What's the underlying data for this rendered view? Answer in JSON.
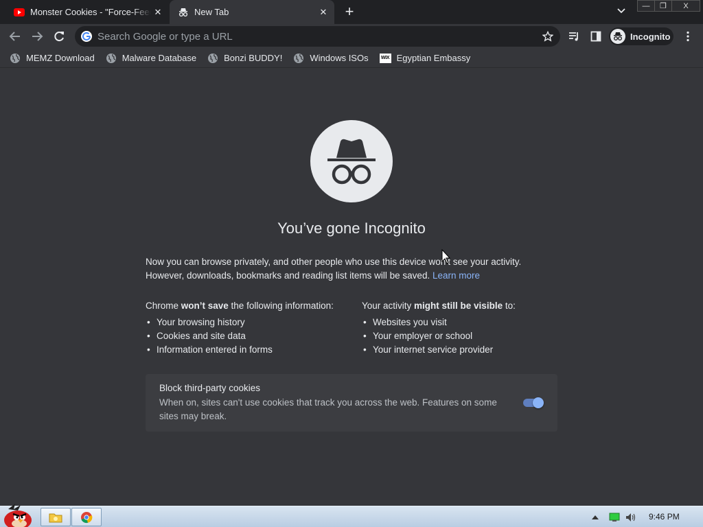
{
  "browser": {
    "tabs": [
      {
        "title": "Monster Cookies - \"Force-Feed",
        "favicon": "youtube-icon",
        "active": false
      },
      {
        "title": "New Tab",
        "favicon": "incognito-icon",
        "active": true
      }
    ],
    "new_tab_symbol": "+",
    "window_controls": {
      "minimize": "—",
      "maximize": "❐",
      "close": "X"
    },
    "omnibox": {
      "placeholder": "Search Google or type a URL",
      "value": ""
    },
    "profile_label": "Incognito",
    "bookmarks": [
      {
        "label": "MEMZ Download",
        "icon": "globe-icon"
      },
      {
        "label": "Malware Database",
        "icon": "globe-icon"
      },
      {
        "label": "Bonzi BUDDY!",
        "icon": "globe-icon"
      },
      {
        "label": "Windows ISOs",
        "icon": "globe-icon"
      },
      {
        "label": "Egyptian Embassy",
        "icon": "wix-icon",
        "icon_text": "WIX"
      }
    ]
  },
  "incognito_page": {
    "heading": "You’ve gone Incognito",
    "intro_line1": "Now you can browse privately, and other people who use this device won’t see your activity.",
    "intro_line2": "However, downloads, bookmarks and reading list items will be saved.",
    "learn_more": "Learn more",
    "left_column": {
      "head_pre": "Chrome ",
      "head_bold": "won’t save",
      "head_post": " the following information:",
      "items": [
        "Your browsing history",
        "Cookies and site data",
        "Information entered in forms"
      ]
    },
    "right_column": {
      "head_pre": "Your activity ",
      "head_bold": "might still be visible",
      "head_post": " to:",
      "items": [
        "Websites you visit",
        "Your employer or school",
        "Your internet service provider"
      ]
    },
    "cookie_card": {
      "title": "Block third-party cookies",
      "description": "When on, sites can't use cookies that track you across the web. Features on some sites may break.",
      "toggle_on": true
    }
  },
  "colors": {
    "background": "#35363a",
    "tabstrip": "#202124",
    "accent": "#8ab4f8",
    "text": "#e8eaed"
  },
  "taskbar": {
    "clock": "9:46 PM"
  }
}
